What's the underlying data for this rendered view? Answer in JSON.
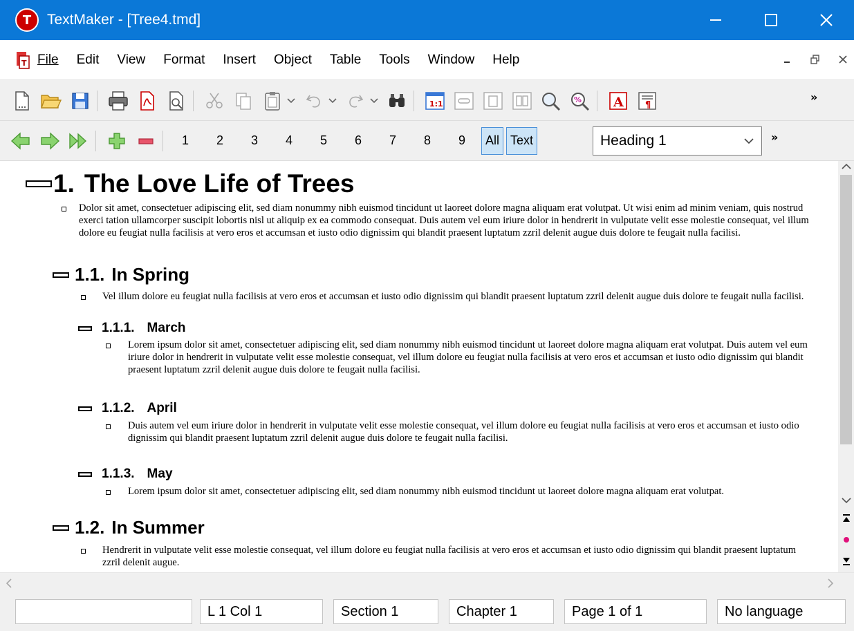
{
  "window": {
    "title": "TextMaker - [Tree4.tmd]",
    "app_icon_letter": "T"
  },
  "menu": {
    "items": [
      "File",
      "Edit",
      "View",
      "Format",
      "Insert",
      "Object",
      "Table",
      "Tools",
      "Window",
      "Help"
    ],
    "mnemonics": [
      "F",
      "E",
      "V",
      "m",
      "I",
      "O",
      "a",
      "T",
      "W",
      "H"
    ]
  },
  "outline_toolbar": {
    "levels": [
      "1",
      "2",
      "3",
      "4",
      "5",
      "6",
      "7",
      "8",
      "9"
    ],
    "all_label": "All",
    "text_label": "Text",
    "style_value": "Heading 1"
  },
  "document": {
    "h1": {
      "number": "1.",
      "text": "The Love Life of Trees"
    },
    "h1_para": "Dolor sit amet, consectetuer adipiscing elit, sed diam nonummy nibh euismod tincidunt ut laoreet dolore magna aliquam erat volutpat. Ut wisi enim ad minim veniam, quis nostrud exerci tation ullamcorper suscipit lobortis nisl ut aliquip ex ea commodo consequat. Duis autem vel eum iriure dolor in hendrerit in vulputate velit esse molestie consequat, vel illum dolore eu feugiat nulla facilisis at vero eros et accumsan et iusto odio dignissim qui blandit praesent luptatum zzril delenit augue duis dolore te feugait nulla facilisi.",
    "h2_spring": {
      "number": "1.1.",
      "text": "In Spring"
    },
    "spring_para": "Vel illum dolore eu feugiat nulla facilisis at vero eros et accumsan et iusto odio dignissim qui blandit praesent luptatum zzril delenit augue duis dolore te feugait nulla facilisi.",
    "h3_march": {
      "number": "1.1.1.",
      "text": "March"
    },
    "march_para": "Lorem ipsum dolor sit amet, consectetuer adipiscing elit, sed diam nonummy nibh euismod tincidunt ut laoreet dolore magna aliquam erat volutpat. Duis autem vel eum iriure dolor in hendrerit in vulputate velit esse molestie consequat, vel illum dolore eu feugiat nulla facilisis at vero eros et accumsan et iusto odio dignissim qui blandit praesent luptatum zzril delenit augue duis dolore te feugait nulla facilisi.",
    "h3_april": {
      "number": "1.1.2.",
      "text": "April"
    },
    "april_para": "Duis autem vel eum iriure dolor in hendrerit in vulputate velit esse molestie consequat, vel illum dolore eu feugiat nulla facilisis at vero eros et accumsan et iusto odio dignissim qui blandit praesent luptatum zzril delenit augue duis dolore te feugait nulla facilisi.",
    "h3_may": {
      "number": "1.1.3.",
      "text": "May"
    },
    "may_para": "Lorem ipsum dolor sit amet, consectetuer adipiscing elit, sed diam nonummy nibh euismod tincidunt ut laoreet dolore magna aliquam erat volutpat.",
    "h2_summer": {
      "number": "1.2.",
      "text": "In Summer"
    },
    "summer_para": "Hendrerit in vulputate velit esse molestie consequat, vel illum dolore eu feugiat nulla facilisis at vero eros et accumsan et iusto odio dignissim qui blandit praesent luptatum zzril delenit augue."
  },
  "status": {
    "field1": "",
    "position": "L 1 Col 1",
    "section": "Section 1",
    "chapter": "Chapter 1",
    "page": "Page 1 of 1",
    "language": "No language"
  },
  "colors": {
    "titlebar": "#0b78d7",
    "active_toggle": "#cce4f7",
    "nav_arrow_green": "#5fba46"
  }
}
